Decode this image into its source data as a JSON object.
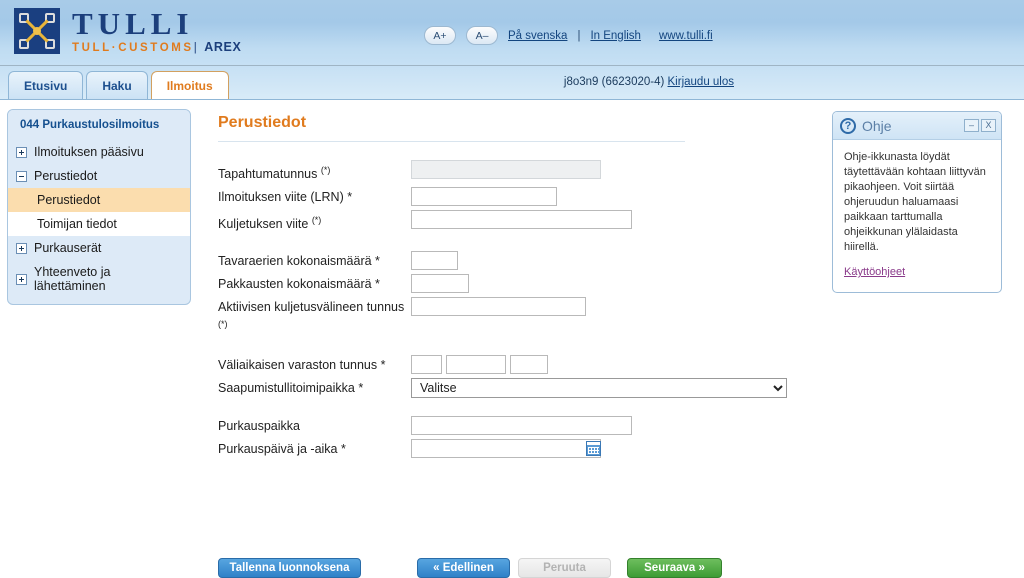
{
  "header": {
    "logo_main": "TULLI",
    "logo_sub": "TULL·CUSTOMS",
    "logo_divider": "|",
    "app_name": "AREX",
    "font_increase": "A+",
    "font_decrease": "A–",
    "lang_sv": "På svenska",
    "lang_sep": "|",
    "lang_en": "In English",
    "site_link": "www.tulli.fi"
  },
  "tabs": [
    {
      "label": "Etusivu",
      "active": false
    },
    {
      "label": "Haku",
      "active": false
    },
    {
      "label": "Ilmoitus",
      "active": true
    }
  ],
  "user": {
    "account": "j8o3n9 (6623020-4)",
    "logout_label": "Kirjaudu ulos"
  },
  "sidebar": {
    "title": "044 Purkaustulosilmoitus",
    "items": [
      {
        "label": "Ilmoituksen pääsivu",
        "state": "collapsed"
      },
      {
        "label": "Perustiedot",
        "state": "expanded"
      },
      {
        "label": "Purkauserät",
        "state": "collapsed"
      },
      {
        "label": "Yhteenveto ja lähettäminen",
        "state": "collapsed"
      }
    ],
    "subitems": [
      {
        "label": "Perustiedot",
        "active": true
      },
      {
        "label": "Toimijan tiedot",
        "active": false
      }
    ]
  },
  "form": {
    "title": "Perustiedot",
    "fields": {
      "tapahtumatunnus": {
        "label": "Tapahtumatunnus",
        "marker": "(*)",
        "value": "",
        "disabled": true
      },
      "lrn": {
        "label": "Ilmoituksen viite (LRN)",
        "marker": "*",
        "value": ""
      },
      "kuljetuksen_viite": {
        "label": "Kuljetuksen viite",
        "marker": "(*)",
        "value": ""
      },
      "tavaraerien": {
        "label": "Tavaraerien kokonaismäärä",
        "marker": "*",
        "value": ""
      },
      "pakkausten": {
        "label": "Pakkausten kokonaismäärä",
        "marker": "*",
        "value": ""
      },
      "aktiivisen": {
        "label": "Aktiivisen kuljetusvälineen tunnus",
        "marker": "(*)",
        "value": ""
      },
      "valiaikaisen": {
        "label": "Väliaikaisen varaston tunnus",
        "marker": "*",
        "value1": "",
        "value2": "",
        "value3": ""
      },
      "saapumistulli": {
        "label": "Saapumistullitoimipaikka",
        "marker": "*",
        "selected": "Valitse",
        "options": [
          "Valitse"
        ]
      },
      "purkauspaikka": {
        "label": "Purkauspaikka",
        "marker": "",
        "value": ""
      },
      "purkauspaiva": {
        "label": "Purkauspäivä ja -aika",
        "marker": "*",
        "value": ""
      }
    }
  },
  "buttons": {
    "save_draft": "Tallenna luonnoksena",
    "previous": "«  Edellinen",
    "cancel": "Peruuta",
    "next": "Seuraava  »"
  },
  "help": {
    "title": "Ohje",
    "minimize": "–",
    "close": "X",
    "body": "Ohje-ikkunasta löydät täytettävään kohtaan liittyvän pikaohjeen. Voit siirtää ohjeruudun haluamaasi paikkaan tarttumalla ohjeikkunan ylälaidasta hiirellä.",
    "link": "Käyttöohjeet"
  }
}
